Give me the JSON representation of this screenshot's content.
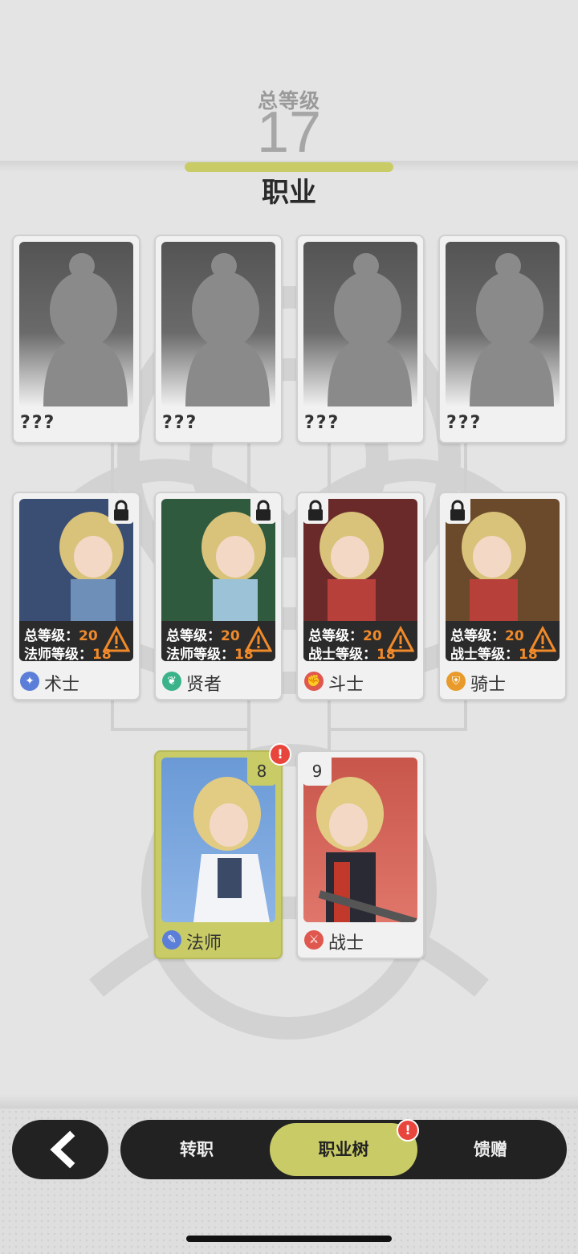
{
  "header": {
    "total_level_label": "总等级",
    "total_level_value": "17",
    "title": "职业"
  },
  "locked_classes": [
    {
      "name": "???"
    },
    {
      "name": "???"
    },
    {
      "name": "???"
    },
    {
      "name": "???"
    }
  ],
  "advanced_classes": [
    {
      "name": "术士",
      "req_total_label": "总等级：",
      "req_total_value": "20",
      "req_class_label": "法师等级：",
      "req_class_value": "18",
      "color": "#3a4e74",
      "icon": "sorcery-icon",
      "icon_color": "#5b7fd8"
    },
    {
      "name": "贤者",
      "req_total_label": "总等级：",
      "req_total_value": "20",
      "req_class_label": "法师等级：",
      "req_class_value": "18",
      "color": "#2f5a3e",
      "icon": "leaf-staff-icon",
      "icon_color": "#3bb38a"
    },
    {
      "name": "斗士",
      "req_total_label": "总等级：",
      "req_total_value": "20",
      "req_class_label": "战士等级：",
      "req_class_value": "18",
      "color": "#6a2a2a",
      "icon": "fist-icon",
      "icon_color": "#e0574e"
    },
    {
      "name": "骑士",
      "req_total_label": "总等级：",
      "req_total_value": "20",
      "req_class_label": "战士等级：",
      "req_class_value": "18",
      "color": "#6a4a2a",
      "icon": "shield-icon",
      "icon_color": "#e89a2a"
    }
  ],
  "base_classes": [
    {
      "name": "法师",
      "level": "8",
      "selected": true,
      "has_alert": true,
      "alert": "!",
      "icon": "staff-icon",
      "icon_color": "#5b7fd8",
      "bg": "#6a9ad6"
    },
    {
      "name": "战士",
      "level": "9",
      "selected": false,
      "has_alert": false,
      "icon": "sword-icon",
      "icon_color": "#e0574e",
      "bg": "#c8564b"
    }
  ],
  "bottom_nav": {
    "back_icon": "chevron-left-icon",
    "tabs": [
      {
        "label": "转职",
        "active": false
      },
      {
        "label": "职业树",
        "active": true,
        "alert": "!"
      },
      {
        "label": "馈赠",
        "active": false
      }
    ]
  },
  "colors": {
    "accent": "#c9cc66",
    "warning": "#f08a2a",
    "alert": "#e8453c"
  }
}
